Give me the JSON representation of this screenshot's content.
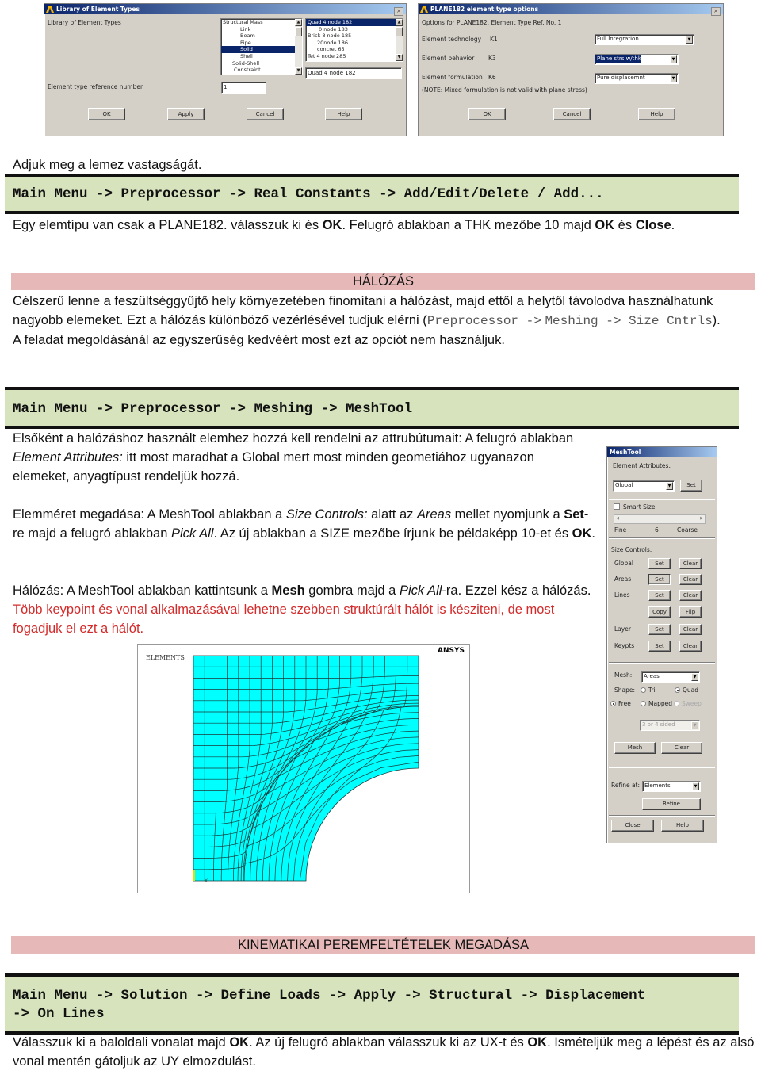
{
  "dialog_library": {
    "title": "Library of Element Types",
    "label_library": "Library of Element Types",
    "list1": [
      "Structural Mass",
      "Link",
      "Beam",
      "Pipe",
      "Solid",
      "Shell",
      "Solid-Shell",
      "Constraint"
    ],
    "list1_selected": "Solid",
    "list2": [
      "Quad  4 node 182",
      "0 node 183",
      "Brick 8 node 185",
      "20node 186",
      "concret 65",
      "Tet  4 node 285"
    ],
    "list2_selected": "Quad  4 node 182",
    "selection_value": "Quad  4 node 182",
    "label_ref": "Element type reference number",
    "ref_value": "1",
    "buttons": {
      "ok": "OK",
      "apply": "Apply",
      "cancel": "Cancel",
      "help": "Help"
    },
    "close": "×"
  },
  "dialog_options": {
    "title": "PLANE182 element type options",
    "subtitle": "Options for PLANE182, Element Type Ref. No. 1",
    "rows": [
      {
        "label": "Element technology",
        "key": "K1",
        "value": "Full Integration"
      },
      {
        "label": "Element behavior",
        "key": "K3",
        "value": "Plane strs w/thk"
      },
      {
        "label": "Element formulation",
        "key": "K6",
        "value": "Pure displacemnt"
      }
    ],
    "note": "(NOTE: Mixed formulation is not valid with plane stress)",
    "buttons": {
      "ok": "OK",
      "cancel": "Cancel",
      "help": "Help"
    },
    "close": "×"
  },
  "doc": {
    "p1": "Adjuk meg a lemez vastagságát.",
    "menu1": "Main Menu -> Preprocessor -> Real Constants -> Add/Edit/Delete / Add...",
    "p2": {
      "a": "Egy elemtípu van csak a PLANE182. válasszuk ki és ",
      "b": "OK",
      "c": ". Felugró ablakban a THK mezőbe 10 majd ",
      "d": "OK",
      "e": " és ",
      "f": "Close",
      "g": "."
    },
    "heading1": "HÁLÓZÁS",
    "p3": {
      "a": "Célszerű lenne a feszültséggyűjtő hely környezetében finomítani a hálózást, majd ettől a helytől távolodva használhatunk nagyobb elemeket. Ezt a hálózás különböző vezérlésével tudjuk elérni (",
      "code1": "Preprocessor ->",
      "code2": "Meshing -> Size Cntrls",
      "b": "). A feladat megoldásánál az egyszerűség kedvéért most ezt az opciót nem használjuk."
    },
    "menu2": "Main Menu -> Preprocessor -> Meshing -> MeshTool",
    "p4": {
      "a": "Elsőként a halózáshoz használt elemhez hozzá kell rendelni az attrubútumait: A felugró ablakban ",
      "i1": "Element Attributes:",
      "b": " itt most maradhat a Global mert most minden geometiához ugyanazon elemeket, anyagtípust rendeljük hozzá."
    },
    "p5": {
      "a": "Elemméret megadása: A MeshTool ablakban a ",
      "i1": "Size Controls:",
      "b": " alatt az ",
      "i2": "Areas",
      "c": " mellet nyomjunk a ",
      "b1": "Set",
      "d": "-re majd a felugró ablakban ",
      "i3": "Pick All",
      "e": ". Az új ablakban a SIZE mezőbe írjunk be példaképp 10-et és ",
      "b2": "OK",
      "f": "."
    },
    "p6": {
      "a": "Hálózás: A MeshTool ablakban kattintsunk a ",
      "b1": "Mesh",
      "b": " gombra majd a ",
      "i1": "Pick All",
      "c": "-ra. Ezzel kész a hálózás. ",
      "red": "Több keypoint és vonal alkalmazásával lehetne szebben struktúrált hálót is késziteni, de most fogadjuk el ezt a hálót."
    },
    "heading2": "KINEMATIKAI PEREMFELTÉTELEK MEGADÁSA",
    "menu3_line1": "Main Menu -> Solution -> Define Loads -> Apply -> Structural -> Displacement",
    "menu3_line2": "-> On Lines",
    "p7": {
      "a": "Válasszuk ki a baloldali vonalat majd ",
      "b1": "OK",
      "b": ". Az új felugró ablakban válasszuk ki az UX-t és ",
      "b2": "OK",
      "c": ". Ismételjük meg a lépést és az alsó vonal mentén gátoljuk az UY elmozdulást."
    }
  },
  "meshtool": {
    "title": "MeshTool",
    "element_attributes_label": "Element Attributes:",
    "attr_value": "Global",
    "set": "Set",
    "smart_size_label": "Smart Size",
    "smart_size_checked": false,
    "slider_fine": "Fine",
    "slider_value": "6",
    "slider_coarse": "Coarse",
    "size_controls_label": "Size Controls:",
    "size_rows": [
      {
        "label": "Global",
        "left": "Set",
        "right": "Clear"
      },
      {
        "label": "Areas",
        "left": "Set",
        "right": "Clear"
      },
      {
        "label": "Lines",
        "left": "Set",
        "right": "Clear"
      },
      {
        "label": "",
        "left": "Copy",
        "right": "Flip"
      },
      {
        "label": "Layer",
        "left": "Set",
        "right": "Clear"
      },
      {
        "label": "Keypts",
        "left": "Set",
        "right": "Clear"
      }
    ],
    "mesh_label": "Mesh:",
    "mesh_value": "Areas",
    "shape_label": "Shape:",
    "shape_tri": "Tri",
    "shape_quad": "Quad",
    "shape_selected": "Quad",
    "free": "Free",
    "mapped": "Mapped",
    "sweep": "Sweep",
    "mesher_selected": "Free",
    "sided_value": "3 or 4 sided",
    "mesh_btn": "Mesh",
    "clear_btn": "Clear",
    "refine_at_label": "Refine at:",
    "refine_value": "Elements",
    "refine_btn": "Refine",
    "close_btn": "Close",
    "help_btn": "Help"
  },
  "mesh_figure": {
    "label": "ELEMENTS",
    "brand": "ANSYS",
    "axis_label": "X",
    "fill_color": "#00ffff",
    "line_color": "#1a3a3a"
  }
}
